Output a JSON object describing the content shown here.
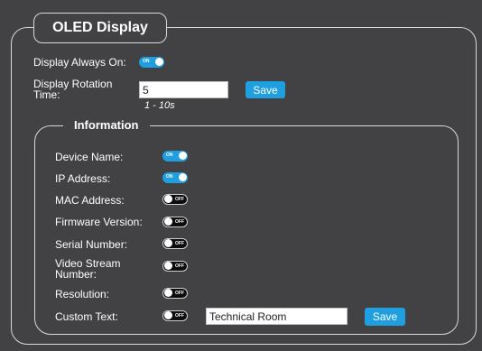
{
  "section_title": "OLED Display",
  "display_always_on": {
    "label": "Display Always On:",
    "state": "ON"
  },
  "rotation_time": {
    "label_line1": "Display Rotation",
    "label_line2": "Time:",
    "value": "5",
    "hint": "1 - 10s",
    "save_label": "Save"
  },
  "information": {
    "title": "Information",
    "items": [
      {
        "label": "Device Name:",
        "state": "ON"
      },
      {
        "label": "IP Address:",
        "state": "ON"
      },
      {
        "label": "MAC Address:",
        "state": "OFF"
      },
      {
        "label": "Firmware Version:",
        "state": "OFF"
      },
      {
        "label": "Serial Number:",
        "state": "OFF"
      },
      {
        "label_line1": "Video Stream",
        "label_line2": "Number:",
        "state": "OFF"
      },
      {
        "label": "Resolution:",
        "state": "OFF"
      },
      {
        "label": "Custom Text:",
        "state": "OFF"
      }
    ],
    "custom_text_value": "Technical Room",
    "custom_save_label": "Save"
  },
  "colors": {
    "accent": "#1f9fe0",
    "background": "#424245",
    "border": "#d8d8d8"
  }
}
